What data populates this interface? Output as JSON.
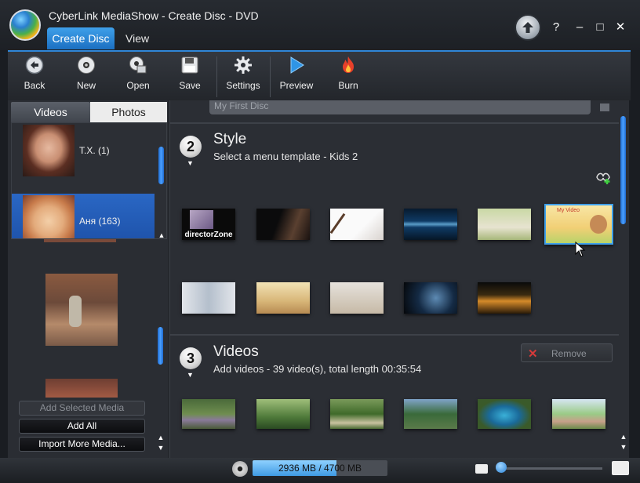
{
  "app": {
    "title": "CyberLink MediaShow - Create Disc - DVD",
    "tabs": [
      "Create Disc",
      "View"
    ]
  },
  "window_controls": {
    "help": "?",
    "minimize": "–",
    "maximize": "□",
    "close": "✕"
  },
  "toolbar": {
    "back": "Back",
    "new": "New",
    "open": "Open",
    "save": "Save",
    "settings": "Settings",
    "preview": "Preview",
    "burn": "Burn"
  },
  "left_panel": {
    "tabs": {
      "videos": "Videos",
      "photos": "Photos"
    },
    "albums": [
      {
        "label": "T.X. (1)"
      },
      {
        "label": "Аня (163)",
        "selected": true
      }
    ],
    "buttons": {
      "add_selected": "Add Selected Media",
      "add_all": "Add All",
      "import_more": "Import More Media..."
    }
  },
  "disc": {
    "name": "My First Disc"
  },
  "style_section": {
    "step": "2",
    "title": "Style",
    "subtitle": "Select a menu template - Kids 2",
    "templates": [
      {
        "label": "directorZone"
      },
      {
        "label": "My Video"
      }
    ],
    "selected_template": "Kids 2"
  },
  "videos_section": {
    "step": "3",
    "title": "Videos",
    "subtitle": "Add videos - 39 video(s), total length 00:35:54",
    "remove_label": "Remove"
  },
  "status": {
    "capacity_text": "2936 MB / 4700 MB",
    "used_fraction": 0.62
  },
  "colors": {
    "accent": "#1f6fc8",
    "background": "#2b2e34"
  }
}
